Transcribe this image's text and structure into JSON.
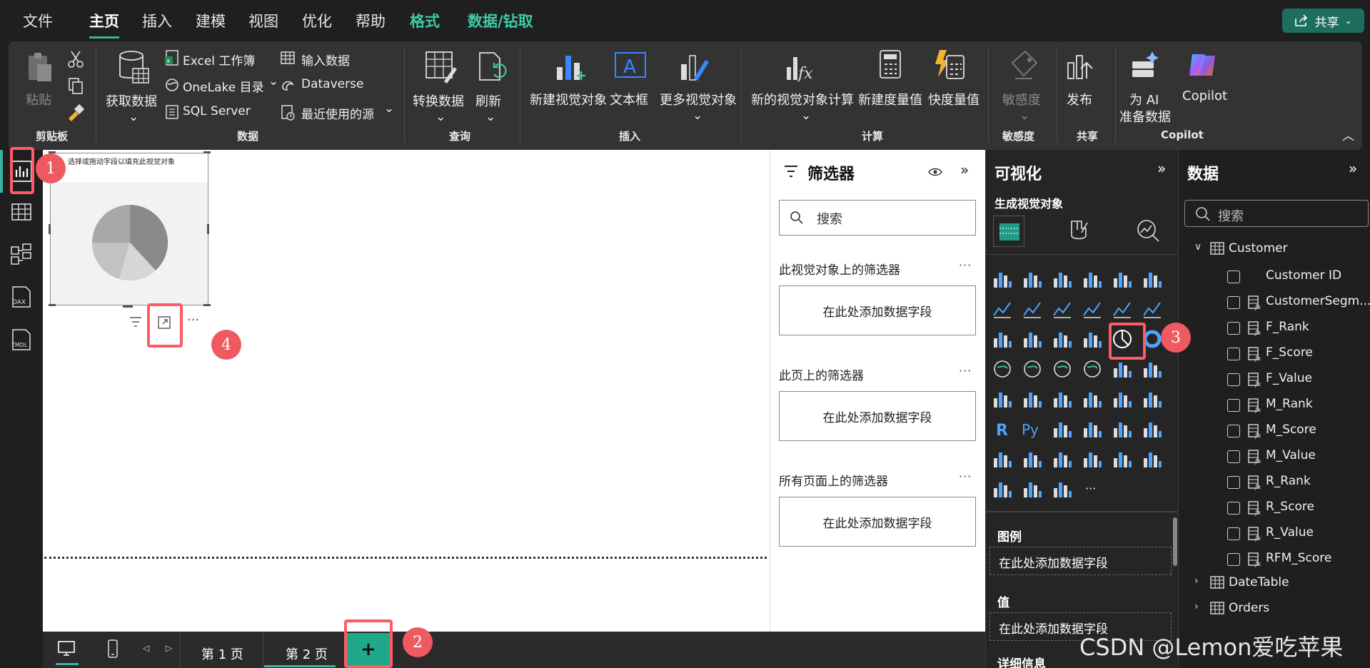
{
  "menu": {
    "items": [
      "文件",
      "主页",
      "插入",
      "建模",
      "视图",
      "优化",
      "帮助",
      "格式",
      "数据/钻取"
    ],
    "active": "主页",
    "share_label": "共享"
  },
  "ribbon": {
    "clipboard": {
      "paste": "粘贴",
      "group": "剪贴板"
    },
    "data": {
      "get_data": "获取数据",
      "excel": "Excel 工作簿",
      "onelake": "OneLake 目录",
      "sql": "SQL Server",
      "enter_data": "输入数据",
      "dataverse": "Dataverse",
      "recent": "最近使用的源",
      "group": "数据"
    },
    "query": {
      "transform": "转换数据",
      "refresh": "刷新",
      "group": "查询"
    },
    "insert": {
      "new_visual": "新建视觉对象",
      "textbox": "文本框",
      "more_visuals": "更多视觉对象",
      "group": "插入"
    },
    "calc": {
      "new_visual_calc": "新的视觉对象计算",
      "new_measure": "新建度量值",
      "quick_measure": "快度量值",
      "group": "计算"
    },
    "sensitivity": {
      "label": "敏感度",
      "group": "敏感度"
    },
    "share": {
      "publish": "发布",
      "group": "共享"
    },
    "copilot": {
      "ai_prep_1": "为 AI",
      "ai_prep_2": "准备数据",
      "copilot": "Copilot",
      "group": "Copilot"
    }
  },
  "canvas": {
    "visual_hint": "选择或拖动字段以填充此视觉对象"
  },
  "filters": {
    "title": "筛选器",
    "search_placeholder": "搜索",
    "sections": [
      {
        "label": "此视觉对象上的筛选器",
        "box": "在此处添加数据字段"
      },
      {
        "label": "此页上的筛选器",
        "box": "在此处添加数据字段"
      },
      {
        "label": "所有页面上的筛选器",
        "box": "在此处添加数据字段"
      }
    ]
  },
  "visualizations": {
    "title": "可视化",
    "subtitle": "生成视觉对象",
    "legend_label": "图例",
    "legend_box": "在此处添加数据字段",
    "values_label": "值",
    "values_box": "在此处添加数据字段",
    "details_label": "详细信息"
  },
  "data_pane": {
    "title": "数据",
    "search_placeholder": "搜索",
    "tables": [
      {
        "name": "Customer",
        "expanded": true,
        "fields": [
          "Customer ID",
          "CustomerSegm...",
          "F_Rank",
          "F_Score",
          "F_Value",
          "M_Rank",
          "M_Score",
          "M_Value",
          "R_Rank",
          "R_Score",
          "R_Value",
          "RFM_Score"
        ]
      },
      {
        "name": "DateTable",
        "expanded": false
      },
      {
        "name": "Orders",
        "expanded": false
      }
    ]
  },
  "pages": {
    "tabs": [
      "第 1 页",
      "第 2 页"
    ],
    "active": "第 2 页",
    "add_label": "+"
  },
  "callouts": [
    "1",
    "2",
    "3",
    "4"
  ],
  "watermark": "CSDN @Lemon爱吃苹果",
  "colors": {
    "accent": "#3bb29a",
    "callout": "#ee5a60",
    "highlight": "#ff5a66"
  }
}
